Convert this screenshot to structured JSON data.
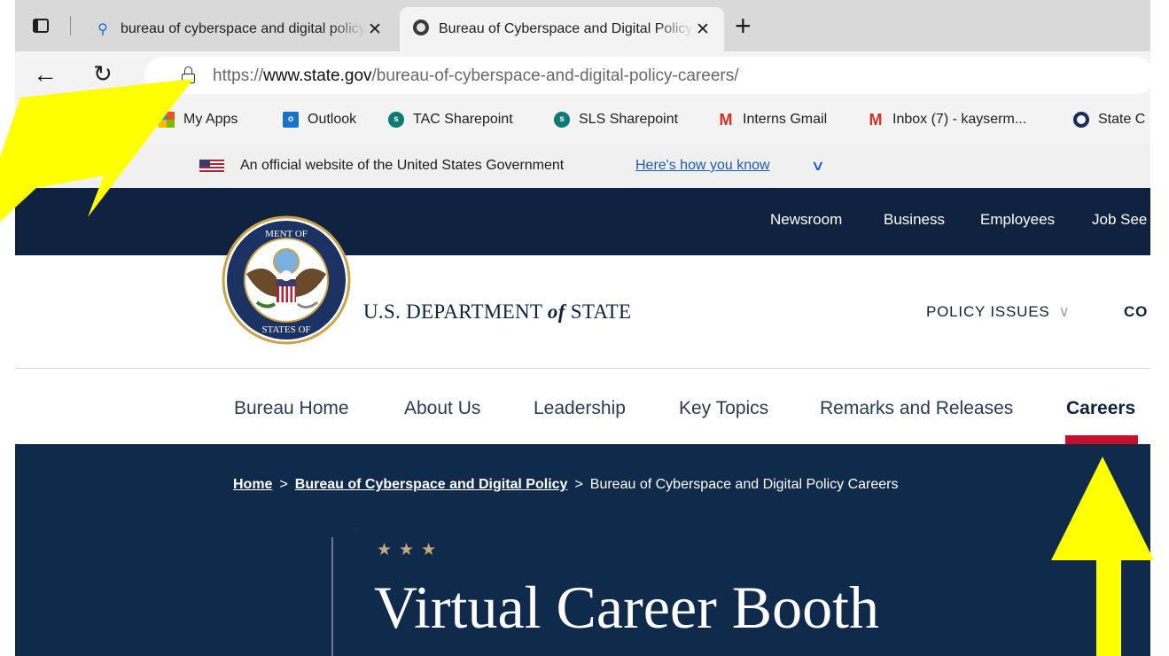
{
  "browser": {
    "tabs": [
      {
        "title": "bureau of cyberspace and digital policy",
        "favicon": "search-icon",
        "active": false
      },
      {
        "title": "Bureau of Cyberspace and Digital Policy Careers",
        "favicon": "state-seal-icon",
        "active": true
      }
    ],
    "new_tab_glyph": "+",
    "close_glyph": "✕",
    "url": {
      "scheme": "https://",
      "host": "www.state.gov",
      "path": "/bureau-of-cyberspace-and-digital-policy-careers/"
    },
    "bookmarks": [
      {
        "label": "My Apps",
        "icon": "microsoft-apps-icon"
      },
      {
        "label": "Outlook",
        "icon": "outlook-icon"
      },
      {
        "label": "TAC Sharepoint",
        "icon": "sharepoint-icon"
      },
      {
        "label": "SLS Sharepoint",
        "icon": "sharepoint-icon"
      },
      {
        "label": "Interns Gmail",
        "icon": "gmail-icon"
      },
      {
        "label": "Inbox (7) - kayserm...",
        "icon": "gmail-icon"
      },
      {
        "label": "State C",
        "icon": "state-icon"
      }
    ]
  },
  "site": {
    "gov_banner": {
      "text": "An official website of the United States Government",
      "link": "Here's how you know"
    },
    "utility_nav": [
      "Newsroom",
      "Business",
      "Employees",
      "Job See"
    ],
    "department_name_pre": "U.S. DEPARTMENT ",
    "department_name_of": "of",
    "department_name_post": " STATE",
    "main_nav": {
      "policy": "POLICY ISSUES",
      "next": "CO"
    },
    "bureau_nav": [
      "Bureau Home",
      "About Us",
      "Leadership",
      "Key Topics",
      "Remarks and Releases",
      "Careers"
    ],
    "active_bureau_item": "Careers",
    "breadcrumb": {
      "home": "Home",
      "bureau": "Bureau of Cyberspace and Digital Policy",
      "current": "Bureau of Cyberspace and Digital Policy Careers",
      "separator": ">"
    },
    "hero": {
      "stars": "★★★",
      "title": "Virtual Career Booth"
    },
    "colors": {
      "navy": "#0f2340",
      "accent_red": "#c8102e",
      "gold": "#c5a87b",
      "annotation_yellow": "#ffff00"
    }
  }
}
